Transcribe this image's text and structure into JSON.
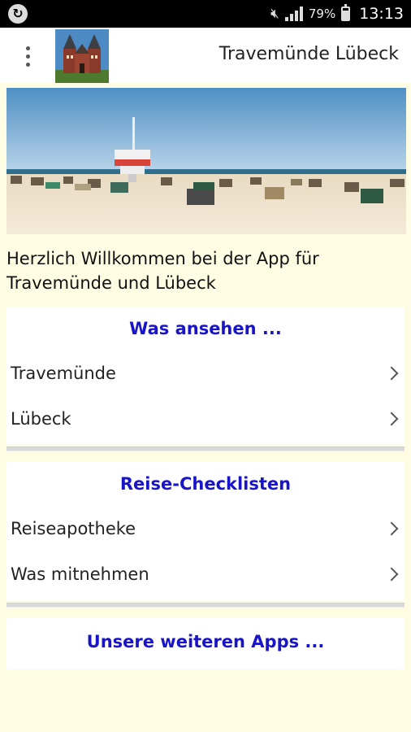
{
  "status_bar": {
    "battery_percent": "79%",
    "time": "13:13",
    "icons": [
      "sync-icon",
      "mute-icon",
      "signal-icon",
      "battery-icon"
    ]
  },
  "app_bar": {
    "title": "Travemünde Lübeck",
    "menu_icon": "overflow-menu-icon",
    "logo": "holstentor-logo"
  },
  "hero_image": "beach-with-lifeguard-tower",
  "welcome_text": "Herzlich Willkommen bei der App für Travemünde und Lübeck",
  "sections": [
    {
      "header": "Was ansehen ...",
      "items": [
        {
          "label": "Travemünde"
        },
        {
          "label": "Lübeck"
        }
      ]
    },
    {
      "header": "Reise-Checklisten",
      "items": [
        {
          "label": "Reiseapotheke"
        },
        {
          "label": "Was mitnehmen"
        }
      ]
    },
    {
      "header": "Unsere weiteren Apps ...",
      "items": []
    }
  ],
  "colors": {
    "background": "#fefde3",
    "section_header": "#1a14c8",
    "status_bar": "#000000"
  }
}
